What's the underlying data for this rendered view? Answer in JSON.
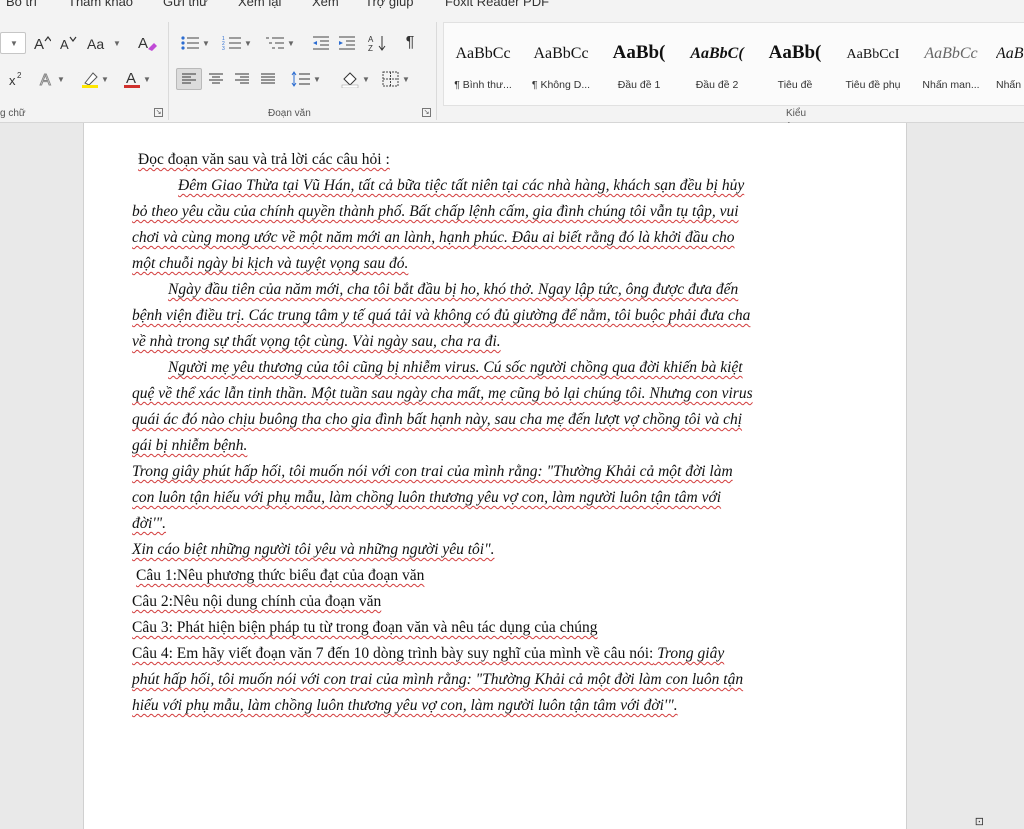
{
  "menubar": {
    "items": [
      "Bố trí",
      "Tham khảo",
      "Gửi thư",
      "Xem lại",
      "Xem",
      "Trợ giúp",
      "Foxit Reader PDF"
    ]
  },
  "ribbon": {
    "font_group_label": "g chữ",
    "paragraph_group_label": "Đoạn văn",
    "styles_group_label": "Kiểu",
    "font_buttons": {
      "grow": "A^",
      "shrink": "Aˇ",
      "case": "Aa",
      "clear": "A",
      "superscript": "x²",
      "text_effects": "A",
      "highlight": "✎",
      "font_color": "A"
    },
    "colors": {
      "highlight": "#ffe600",
      "font_color": "#d0312d"
    },
    "styles": [
      {
        "preview": "AaBbCc",
        "name": "¶ Bình thư..."
      },
      {
        "preview": "AaBbCc",
        "name": "¶ Không D..."
      },
      {
        "preview": "AaBb(",
        "name": "Đầu đề 1"
      },
      {
        "preview": "AaBbC(",
        "name": "Đầu đề 2"
      },
      {
        "preview": "AaBb(",
        "name": "Tiêu đề"
      },
      {
        "preview": "AaBbCcI",
        "name": "Tiêu đề phụ"
      },
      {
        "preview": "AaBbCc",
        "name": "Nhấn man..."
      },
      {
        "preview": "AaB",
        "name": "Nhấn"
      }
    ]
  },
  "document": {
    "lines": [
      "Đọc đoạn văn sau và trả lời các câu hỏi :",
      "Đêm Giao Thừa tại Vũ Hán, tất cả bữa tiệc tất niên tại các nhà hàng, khách sạn đều bị hủy",
      "bỏ theo yêu cầu của chính quyền thành phố. Bất chấp lệnh cấm, gia đình chúng tôi vẫn tụ tập, vui",
      "chơi và cùng mong ước về một năm mới an lành, hạnh phúc. Đâu ai biết rằng đó là khởi đầu cho",
      "một chuỗi ngày bi kịch và tuyệt vọng sau đó.",
      "Ngày đầu tiên của năm mới, cha tôi bắt đầu bị ho, khó thở. Ngay lập tức, ông được đưa đến",
      "bệnh viện điều trị. Các trung tâm y tế quá tải và không có đủ giường để nằm, tôi buộc phải đưa cha",
      "về nhà trong sự thất vọng tột cùng. Vài ngày sau, cha ra đi.",
      "Người mẹ yêu thương của tôi cũng bị nhiễm virus. Cú sốc người chồng qua đời khiến bà kiệt",
      "quệ về thể xác lẫn tinh thần. Một tuần sau ngày cha mất, mẹ cũng bỏ lại chúng tôi. Nhưng con virus",
      "quái ác đó nào chịu buông tha cho gia đình bất hạnh này, sau cha mẹ đến lượt vợ chồng tôi và chị",
      "gái bị nhiễm bệnh.",
      "Trong giây phút hấp hối, tôi muốn nói với con trai của mình rằng: \"Thường Khải cả một đời làm",
      "con luôn tận hiếu với phụ mẫu, làm chồng luôn thương yêu vợ con, làm người luôn tận tâm với",
      "đời'\".",
      "Xin cáo biệt những người tôi yêu và những người yêu tôi\".",
      "Câu 1:Nêu phương thức biểu đạt của  đoạn văn",
      "Câu 2:Nêu nội dung chính của đoạn văn",
      "Câu 3: Phát hiện biện pháp tu từ trong đoạn văn  và nêu tác dụng của chúng",
      "Câu 4: Em hãy  viết đoạn văn 7 đến 10 dòng  trình bày suy nghĩ của mình về câu nói:",
      " Trong giây",
      "phút hấp hối, tôi muốn nói với con trai của mình rằng: \"Thường Khải cả một đời làm con luôn tận",
      "hiếu với phụ mẫu, làm chồng luôn thương yêu vợ con, làm người luôn tận tâm với đời'\"."
    ]
  },
  "statusbar": {
    "zoom_hint": "⊡"
  }
}
